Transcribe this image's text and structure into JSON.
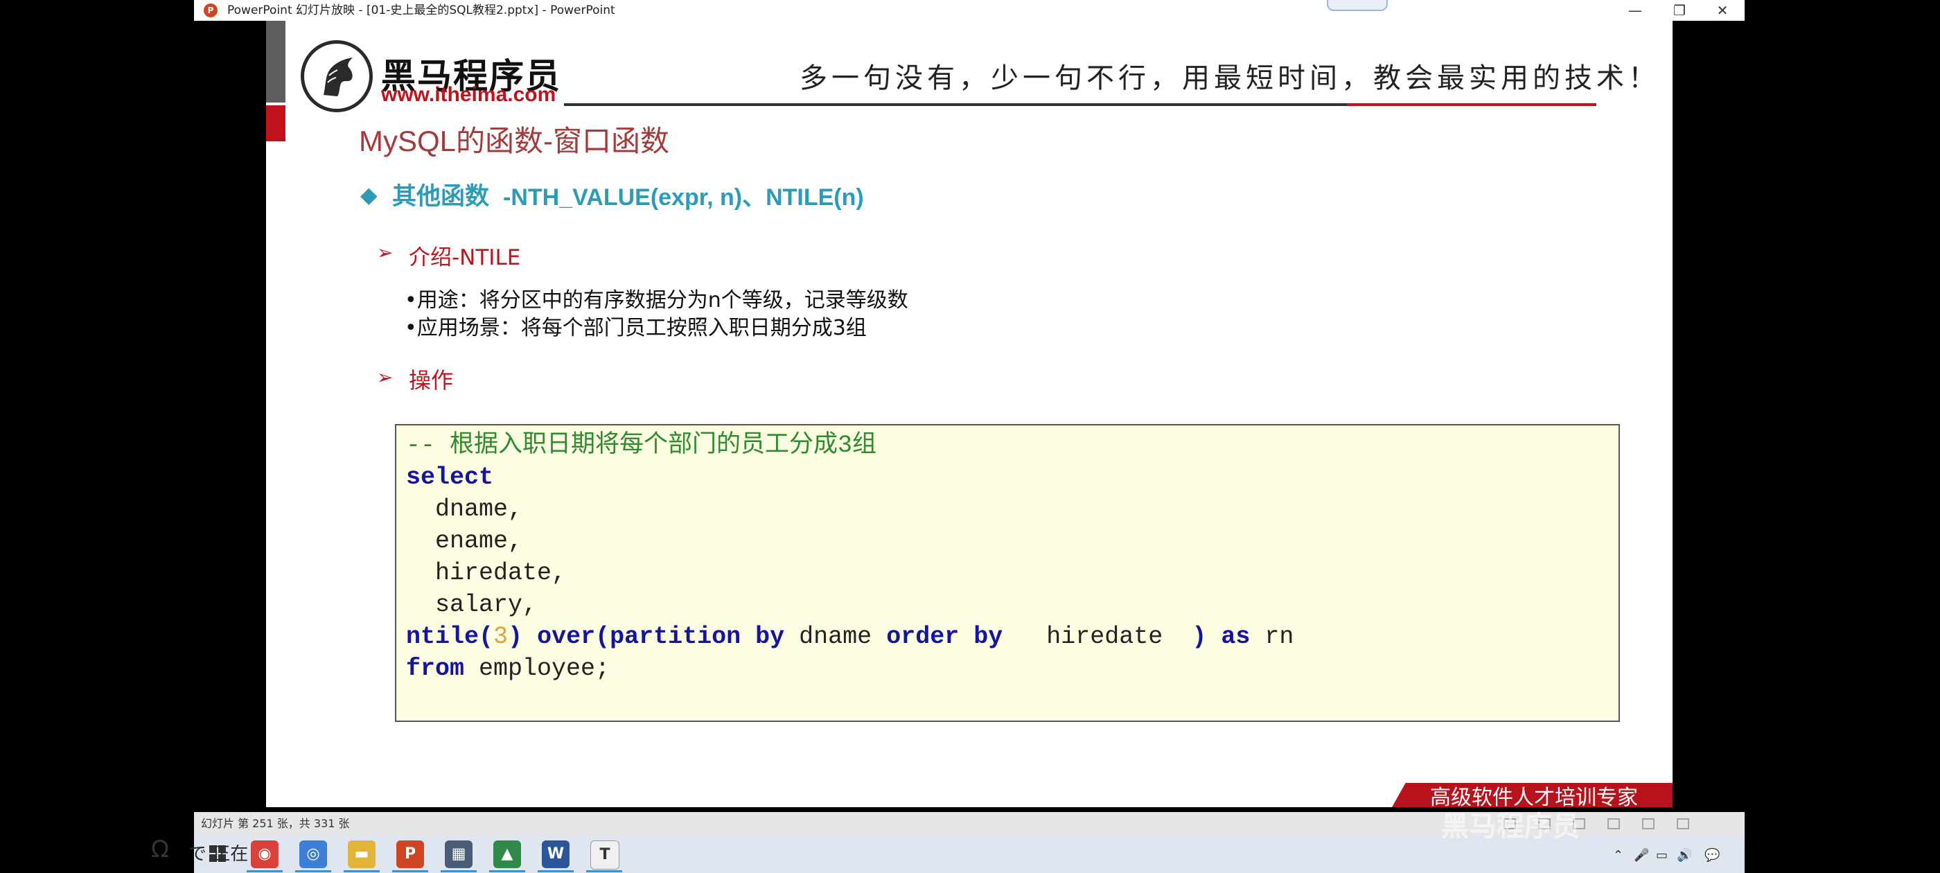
{
  "window": {
    "title": "PowerPoint 幻灯片放映 - [01-史上最全的SQL教程2.pptx] - PowerPoint",
    "app_icon": "P",
    "controls": {
      "minimize": "—",
      "restore": "❐",
      "close": "✕"
    }
  },
  "slide": {
    "logo": {
      "name": "黑马程序员",
      "url": "www.itheima.com"
    },
    "slogan": "多一句没有，少一句不行，用最短时间，教会最实用的技术！",
    "title": "MySQL的函数-窗口函数",
    "heading": {
      "bullet": "◆",
      "prefix": "其他函数",
      "rest": "-NTH_VALUE(expr, n)、NTILE(n)"
    },
    "intro": {
      "arrow": "➢",
      "label": "介绍-NTILE"
    },
    "bullets": [
      "•用途：将分区中的有序数据分为n个等级，记录等级数",
      "•应用场景：将每个部门员工按照入职日期分成3组"
    ],
    "ops": {
      "arrow": "➢",
      "label": "操作"
    },
    "code": {
      "comment": "-- 根据入职日期将每个部门的员工分成3组",
      "select": "select",
      "cols": [
        "  dname,",
        "  ename,",
        "  hiredate,",
        "  salary,"
      ],
      "ntile": "ntile",
      "open_paren": "(",
      "arg": "3",
      "close_paren": ")",
      "over": "over",
      "partition_kw": "(partition by",
      "partition_col": "dname",
      "order_kw": "order by",
      "order_col": "  hiredate  ",
      "end_paren": ")",
      "as_kw": "as",
      "alias": "rn",
      "from_kw": "from",
      "table": "employee;"
    },
    "ribbon": "高级软件人才培训专家"
  },
  "statusbar": {
    "text": "幻灯片 第 251 张，共 331 张"
  },
  "taskbar": {
    "apps": [
      {
        "name": "chrome",
        "glyph": "◉",
        "color": "#d8423a"
      },
      {
        "name": "browser",
        "glyph": "◎",
        "color": "#3d7fd6"
      },
      {
        "name": "file-explorer",
        "glyph": "▬",
        "color": "#e2b53a"
      },
      {
        "name": "powerpoint",
        "glyph": "P",
        "color": "#d04424"
      },
      {
        "name": "calculator",
        "glyph": "▦",
        "color": "#4a5d78"
      },
      {
        "name": "chart-app",
        "glyph": "▲",
        "color": "#2f8a4a"
      },
      {
        "name": "word",
        "glyph": "W",
        "color": "#2b579a"
      },
      {
        "name": "typora",
        "glyph": "T",
        "color": "#f0f0f0"
      }
    ],
    "tray": [
      "⌃",
      "🎤",
      "▭",
      "🔊",
      "💬"
    ]
  },
  "overlay": {
    "watermark": "黑马程序员",
    "left_icon": "Ω",
    "left_text": "で 正在"
  }
}
